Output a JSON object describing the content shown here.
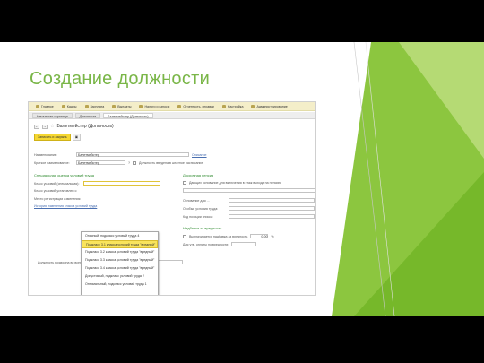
{
  "slide": {
    "title": "Создание должности",
    "accent": "#7ab648"
  },
  "menu": [
    {
      "icon": "home-icon",
      "label": "Главное"
    },
    {
      "icon": "people-icon",
      "label": "Кадры"
    },
    {
      "icon": "money-icon",
      "label": "Зарплата"
    },
    {
      "icon": "cash-icon",
      "label": "Выплаты"
    },
    {
      "icon": "tax-icon",
      "label": "Налоги и взносы"
    },
    {
      "icon": "report-icon",
      "label": "Отчетность, справки"
    },
    {
      "icon": "gear-icon",
      "label": "Настройка"
    },
    {
      "icon": "admin-icon",
      "label": "Администрирование"
    }
  ],
  "tabs": [
    "Начальная страница",
    "Должности",
    "Балетмейстер (Должность)"
  ],
  "header": {
    "back": "←",
    "forward": "→",
    "title": "Балетмейстер (Должность)"
  },
  "toolbar": {
    "save_close": "Записать и закрыть",
    "save": "▣",
    "more": "⋯"
  },
  "form": {
    "name_label": "Наименование:",
    "name_value": "Балетмейстер",
    "name_link": "Описание",
    "short_label": "Краткое наименование:",
    "short_value": "Балетмейстер",
    "short_help": "?",
    "hidden_label": "Должность введена в штатное расписание",
    "labor_section": "Специальная оценка условий труда",
    "class_label": "Класс условий (специальная):",
    "class_value": "",
    "class_set_label": "Класс условий установлен с:",
    "place_label": "Место регистрации изменения:",
    "history_link": "История изменения класса условий труда",
    "bottom_label": "Должность возможна во всех штатных расписаниях по штатному расписанию:",
    "pension_section": "Досрочная пенсия",
    "pension_check": "Дающих основание для включения в стаж выхода на пенсию",
    "work_label": "Основание для ...",
    "conditions_label": "Особые условия труда:",
    "position_code_label": "Код позиции списка:",
    "harm_section": "Надбавка за вредность",
    "harm_check": "Выплачивается надбавка за вредность",
    "harm_value": "0,00",
    "harm_percent": "%",
    "harm_basis": "Для утв. оплаты по вредности:"
  },
  "dropdown": {
    "options": [
      "Опасный, подкласс условий труда 4",
      "Подкласс 3.1 класса условий труда \"вредный\"",
      "Подкласс 3.2 класса условий труда \"вредный\"",
      "Подкласс 3.3 класса условий труда \"вредный\"",
      "Подкласс 3.4 класса условий труда \"вредный\"",
      "Допустимый, подкласс условий труда 2",
      "Оптимальный, подкласс условий труда 1"
    ],
    "selected": 1
  }
}
